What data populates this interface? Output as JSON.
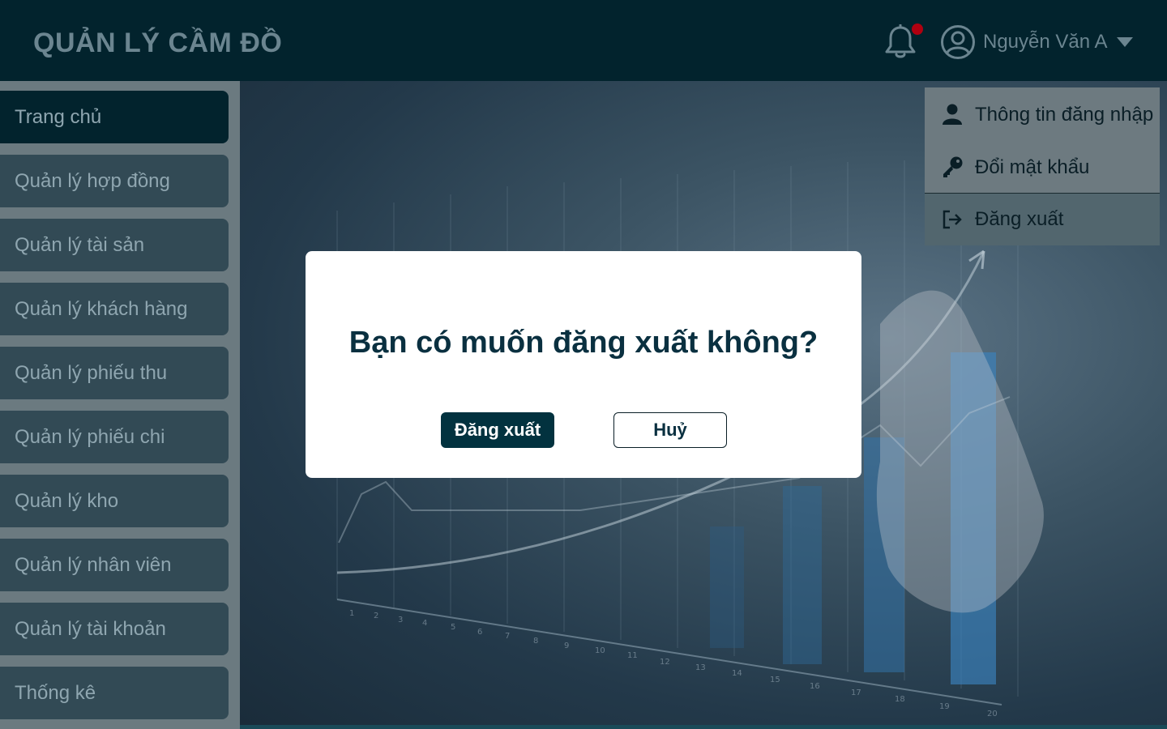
{
  "header": {
    "app_title": "QUẢN LÝ CẦM ĐỒ",
    "user_name": "Nguyễn Văn A",
    "notification_icon": "bell-icon",
    "avatar_icon": "user-circle-icon",
    "caret_icon": "caret-down-icon"
  },
  "sidebar": {
    "items": [
      {
        "label": "Trang chủ",
        "active": true
      },
      {
        "label": "Quản lý hợp đồng"
      },
      {
        "label": "Quản lý tài sản"
      },
      {
        "label": "Quản lý khách hàng"
      },
      {
        "label": "Quản lý phiếu thu"
      },
      {
        "label": "Quản lý phiếu chi"
      },
      {
        "label": "Quản lý kho"
      },
      {
        "label": "Quản lý nhân viên"
      },
      {
        "label": "Quản lý tài khoản"
      },
      {
        "label": "Thống kê"
      }
    ]
  },
  "user_menu": {
    "items": [
      {
        "label": "Thông tin đăng nhập",
        "icon": "user-icon"
      },
      {
        "label": "Đổi mật khẩu",
        "icon": "key-icon"
      },
      {
        "label": "Đăng xuất",
        "icon": "sign-out-icon"
      }
    ]
  },
  "modal": {
    "question": "Bạn có muốn đăng xuất không?",
    "confirm_label": "Đăng xuất",
    "cancel_label": "Huỷ"
  },
  "colors": {
    "header_bg": "#02232d",
    "nav_bg": "#324a55",
    "primary_button": "#02323f",
    "notification_dot": "#b00010"
  }
}
